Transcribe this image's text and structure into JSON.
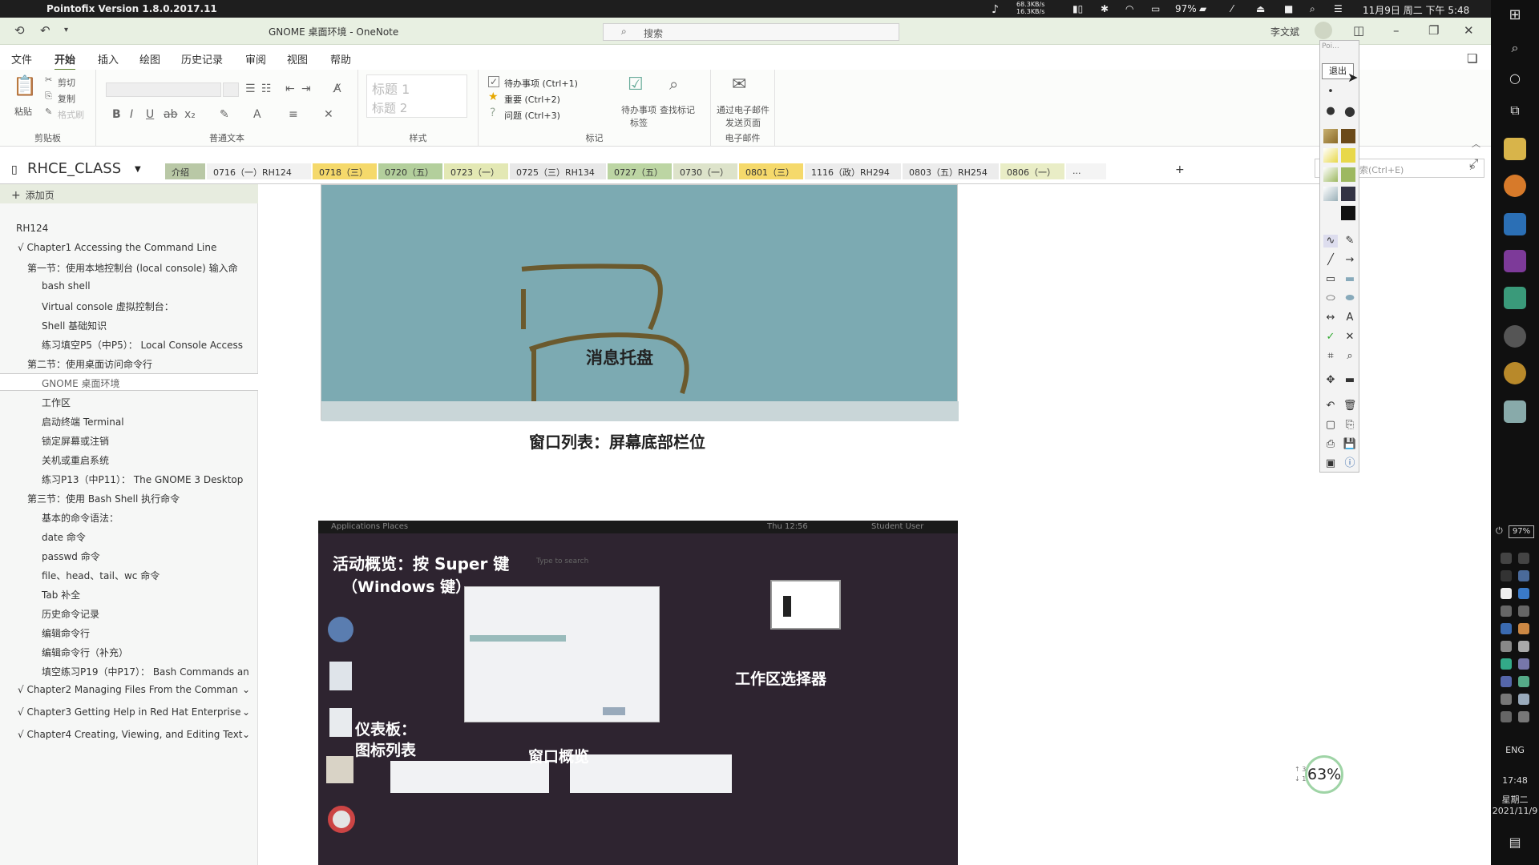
{
  "macbar": {
    "app_title": "Pointofix Version 1.8.0.2017.11",
    "net_up": "68.3KB/s",
    "net_down": "16.3KB/s",
    "battery": "97%",
    "datetime": "11月9日 周二 下午 5:48"
  },
  "window": {
    "title": "GNOME 桌面环境  -  OneNote",
    "search_placeholder": "搜索",
    "user": "李文斌"
  },
  "menu": [
    "文件",
    "开始",
    "插入",
    "绘图",
    "历史记录",
    "审阅",
    "视图",
    "帮助"
  ],
  "menu_active": "开始",
  "ribbon": {
    "clipboard": {
      "paste": "粘贴",
      "cut": "剪切",
      "copy": "复制",
      "format": "格式刷",
      "label": "剪贴板"
    },
    "basic_text_label": "普通文本",
    "styles": {
      "h1": "标题 1",
      "h2": "标题 2",
      "label": "样式"
    },
    "tags": {
      "todo": "待办事项 (Ctrl+1)",
      "important": "重要 (Ctrl+2)",
      "question": "问题 (Ctrl+3)",
      "todo_tag": "待办事项标签",
      "find_tags": "查找标记",
      "label": "标记"
    },
    "email": {
      "send": "通过电子邮件发送页面",
      "label": "电子邮件"
    }
  },
  "notebook": {
    "name": "RHCE_CLASS",
    "search_placeholder": "搜索(Ctrl+E)"
  },
  "section_tabs": [
    {
      "label": "介绍",
      "color": "#b9c8a6"
    },
    {
      "label": "0716（一）RH124",
      "color": "#f1f1f1"
    },
    {
      "label": "0718（三）",
      "color": "#f5d96b"
    },
    {
      "label": "0720（五）",
      "color": "#b3cf9c"
    },
    {
      "label": "0723（一）",
      "color": "#e3e8b4"
    },
    {
      "label": "0725（三）RH134",
      "color": "#e8e8e8"
    },
    {
      "label": "0727（五）",
      "color": "#bcd5a3"
    },
    {
      "label": "0730（一）",
      "color": "#dde3ca"
    },
    {
      "label": "0801（三）",
      "color": "#f5d96b"
    },
    {
      "label": "1116（政）RH294",
      "color": "#ececec"
    },
    {
      "label": "0803（五）RH254",
      "color": "#ececec"
    },
    {
      "label": "0806（一）",
      "color": "#e9edc6"
    },
    {
      "label": "...",
      "color": "#f4f4f4"
    }
  ],
  "sidebar": {
    "add_page": "添加页",
    "pages": [
      {
        "text": "RH124",
        "indent": 0,
        "sel": false
      },
      {
        "text": "√ Chapter1 Accessing the Command Line",
        "indent": 1,
        "sel": false
      },
      {
        "text": "第一节：使用本地控制台 (local console) 输入命",
        "indent": 2,
        "sel": false
      },
      {
        "text": "bash shell",
        "indent": 3,
        "sel": false
      },
      {
        "text": "Virtual console 虚拟控制台：",
        "indent": 3,
        "sel": false
      },
      {
        "text": "Shell 基础知识",
        "indent": 3,
        "sel": false
      },
      {
        "text": "练习填空P5（中P5）：  Local Console Access",
        "indent": 3,
        "sel": false
      },
      {
        "text": "第二节：使用桌面访问命令行",
        "indent": 2,
        "sel": false
      },
      {
        "text": "GNOME 桌面环境",
        "indent": 3,
        "sel": true
      },
      {
        "text": "工作区",
        "indent": 3,
        "sel": false
      },
      {
        "text": "启动终端 Terminal",
        "indent": 3,
        "sel": false
      },
      {
        "text": "锁定屏幕或注销",
        "indent": 3,
        "sel": false
      },
      {
        "text": "关机或重启系统",
        "indent": 3,
        "sel": false
      },
      {
        "text": "练习P13（中P11）：  The GNOME 3 Desktop",
        "indent": 3,
        "sel": false
      },
      {
        "text": "第三节：使用 Bash Shell 执行命令",
        "indent": 2,
        "sel": false
      },
      {
        "text": "基本的命令语法：",
        "indent": 3,
        "sel": false
      },
      {
        "text": "date 命令",
        "indent": 3,
        "sel": false
      },
      {
        "text": "passwd 命令",
        "indent": 3,
        "sel": false
      },
      {
        "text": "file、head、tail、wc 命令",
        "indent": 3,
        "sel": false
      },
      {
        "text": "Tab 补全",
        "indent": 3,
        "sel": false
      },
      {
        "text": "历史命令记录",
        "indent": 3,
        "sel": false
      },
      {
        "text": "编辑命令行",
        "indent": 3,
        "sel": false
      },
      {
        "text": "编辑命令行（补充）",
        "indent": 3,
        "sel": false
      },
      {
        "text": "填空练习P19（中P17）：  Bash Commands an",
        "indent": 3,
        "sel": false
      }
    ],
    "chapters": [
      "√ Chapter2 Managing Files From the Comman",
      "√ Chapter3 Getting Help in Red Hat Enterprise",
      "√ Chapter4 Creating, Viewing, and Editing Text"
    ]
  },
  "content": {
    "img1_label": "消息托盘",
    "caption1": "窗口列表：屏幕底部栏位",
    "img2_topbar": "Applications   Places",
    "img2_time": "Thu 12:56",
    "img2_user": "Student User",
    "img2_search": "Type to search",
    "overview_label_1": "活动概览：按 Super 键",
    "overview_label_2": "（Windows 键）",
    "workspace_selector": "工作区选择器",
    "dash_label_1": "仪表板：",
    "dash_label_2": "图标列表",
    "window_overview": "窗口概览"
  },
  "drawtool": {
    "exit": "退出",
    "title": "Poi..."
  },
  "widget": {
    "cpu": "63%",
    "net_up": "↑ 31  K/s",
    "net_down": "↓ 10  K/s"
  },
  "taskbar": {
    "battery": "97%",
    "lang": "ENG",
    "time": "17:48",
    "day": "星期二",
    "date": "2021/11/9"
  }
}
